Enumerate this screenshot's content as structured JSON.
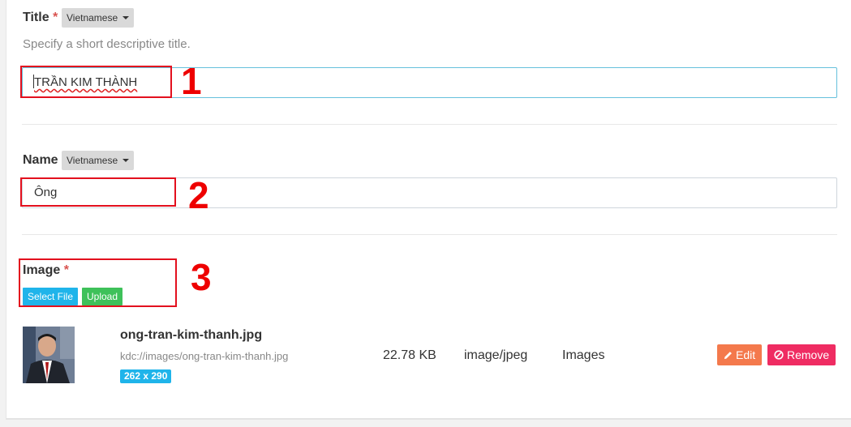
{
  "title_field": {
    "label": "Title",
    "required_mark": "*",
    "language": "Vietnamese",
    "help_text": "Specify a short descriptive title.",
    "value": "TRẦN KIM THÀNH"
  },
  "name_field": {
    "label": "Name",
    "language": "Vietnamese",
    "value": "Ông"
  },
  "image_field": {
    "label": "Image",
    "required_mark": "*",
    "select_file_label": "Select File",
    "upload_label": "Upload"
  },
  "file": {
    "name": "ong-tran-kim-thanh.jpg",
    "path": "kdc://images/ong-tran-kim-thanh.jpg",
    "dimensions": "262 x 290",
    "size": "22.78 KB",
    "mime": "image/jpeg",
    "category": "Images",
    "edit_label": "Edit",
    "remove_label": "Remove"
  },
  "annotations": {
    "n1": "1",
    "n2": "2",
    "n3": "3"
  },
  "colors": {
    "annotation_red": "#e3101e",
    "select_file_bg": "#1fb4ea",
    "upload_bg": "#3ec15a",
    "edit_bg": "#f4794c",
    "remove_bg": "#ef2c62"
  }
}
